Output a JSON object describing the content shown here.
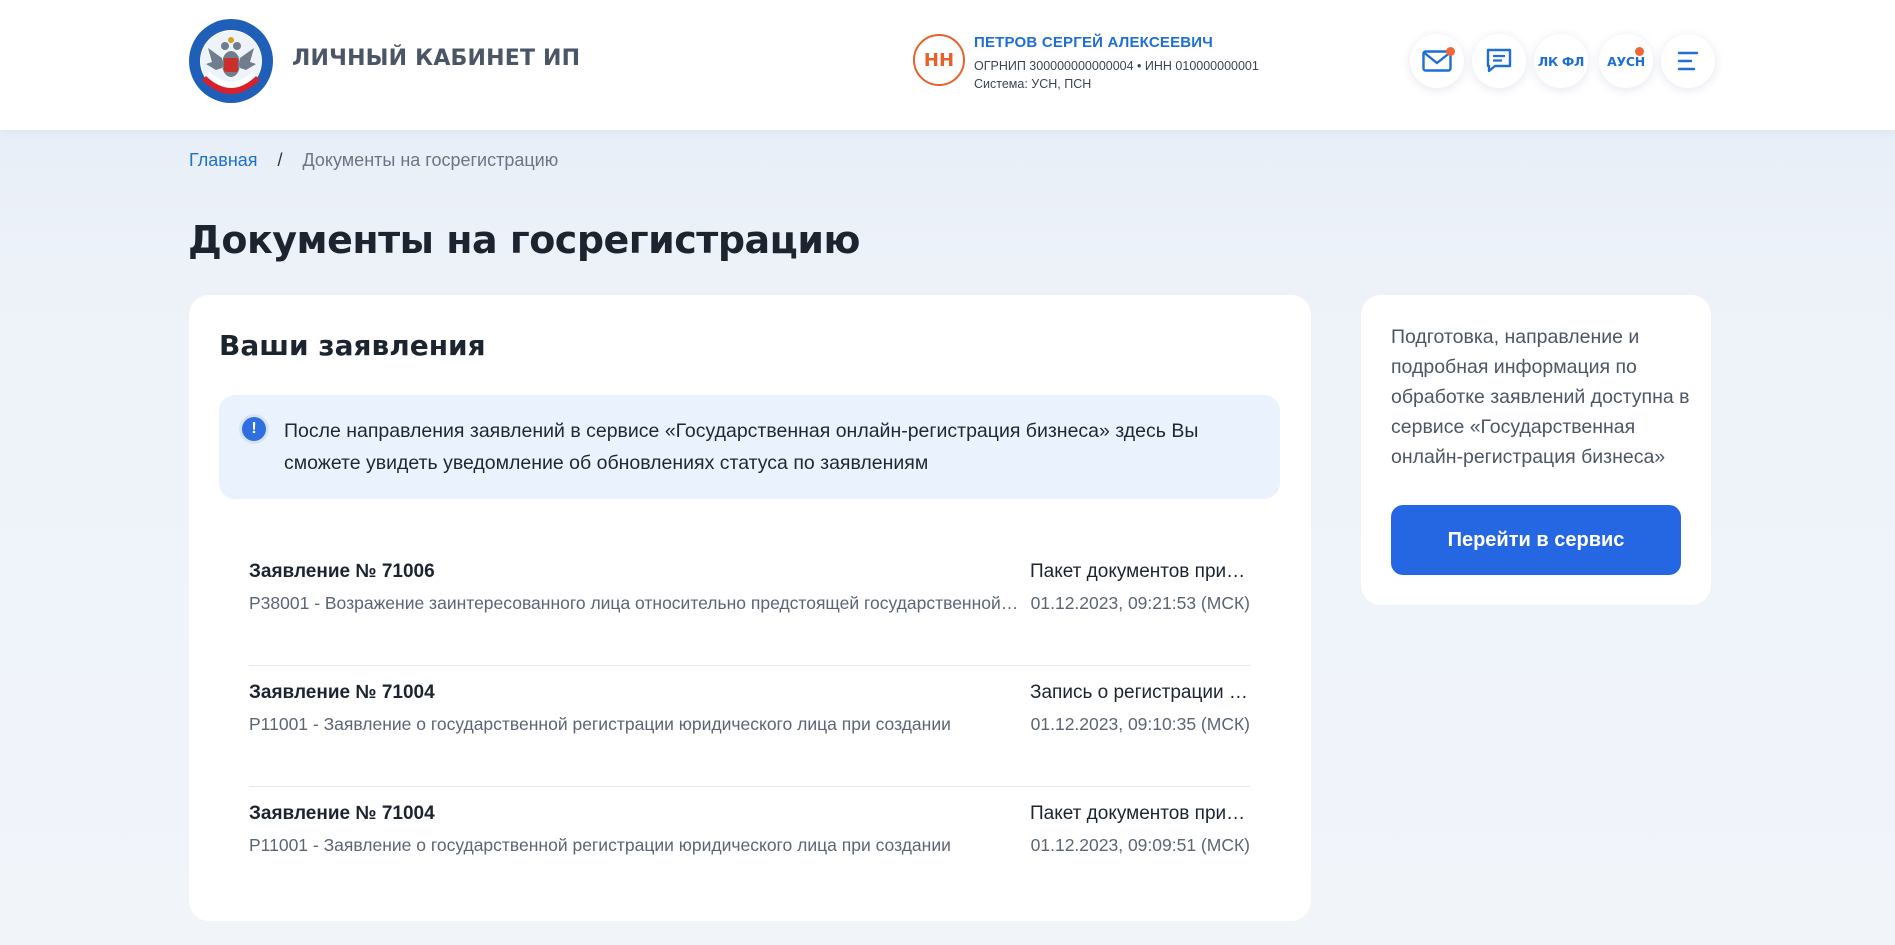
{
  "header": {
    "app_title": "ЛИЧНЫЙ КАБИНЕТ ИП",
    "user": {
      "initials": "НН",
      "name": "ПЕТРОВ СЕРГЕЙ АЛЕКСЕЕВИЧ",
      "ids": "ОГРНИП 300000000000004 • ИНН 010000000001",
      "system": "Система: УСН, ПСН"
    },
    "buttons": {
      "lk_fl": "ЛК ФЛ",
      "ausn": "АУСН"
    },
    "accent_color": "#1d6fd6",
    "notification_dot_color": "#f0653a"
  },
  "breadcrumb": {
    "home": "Главная",
    "separator": "/",
    "current": "Документы на госрегистрацию"
  },
  "page_title": "Документы на госрегистрацию",
  "main": {
    "title": "Ваши заявления",
    "notice_icon": "!",
    "notice": "После направления заявлений в сервисе «Государственная онлайн-регистрация бизнеса» здесь Вы сможете увидеть уведомление об обновлениях статуса по заявлениям",
    "applications": [
      {
        "number": "Заявление № 71006",
        "description": "Р38001 - Возражение заинтересованного лица относительно предстоящей государственной регистрации",
        "status": "Пакет документов принят",
        "date": "01.12.2023, 09:21:53 (МСК)"
      },
      {
        "number": "Заявление № 71004",
        "description": "Р11001 - Заявление о государственной регистрации юридического лица при создании",
        "status": "Запись о регистрации внесена",
        "date": "01.12.2023, 09:10:35 (МСК)"
      },
      {
        "number": "Заявление № 71004",
        "description": "Р11001 - Заявление о государственной регистрации юридического лица при создании",
        "status": "Пакет документов принят",
        "date": "01.12.2023, 09:09:51 (МСК)"
      }
    ]
  },
  "side": {
    "text": "Подготовка, направление и подробная информация по обработке заявлений доступна в сервисе «Государственная онлайн-регистрация бизнеса»",
    "button_label": "Перейти в сервис",
    "button_color": "#2566e3"
  }
}
